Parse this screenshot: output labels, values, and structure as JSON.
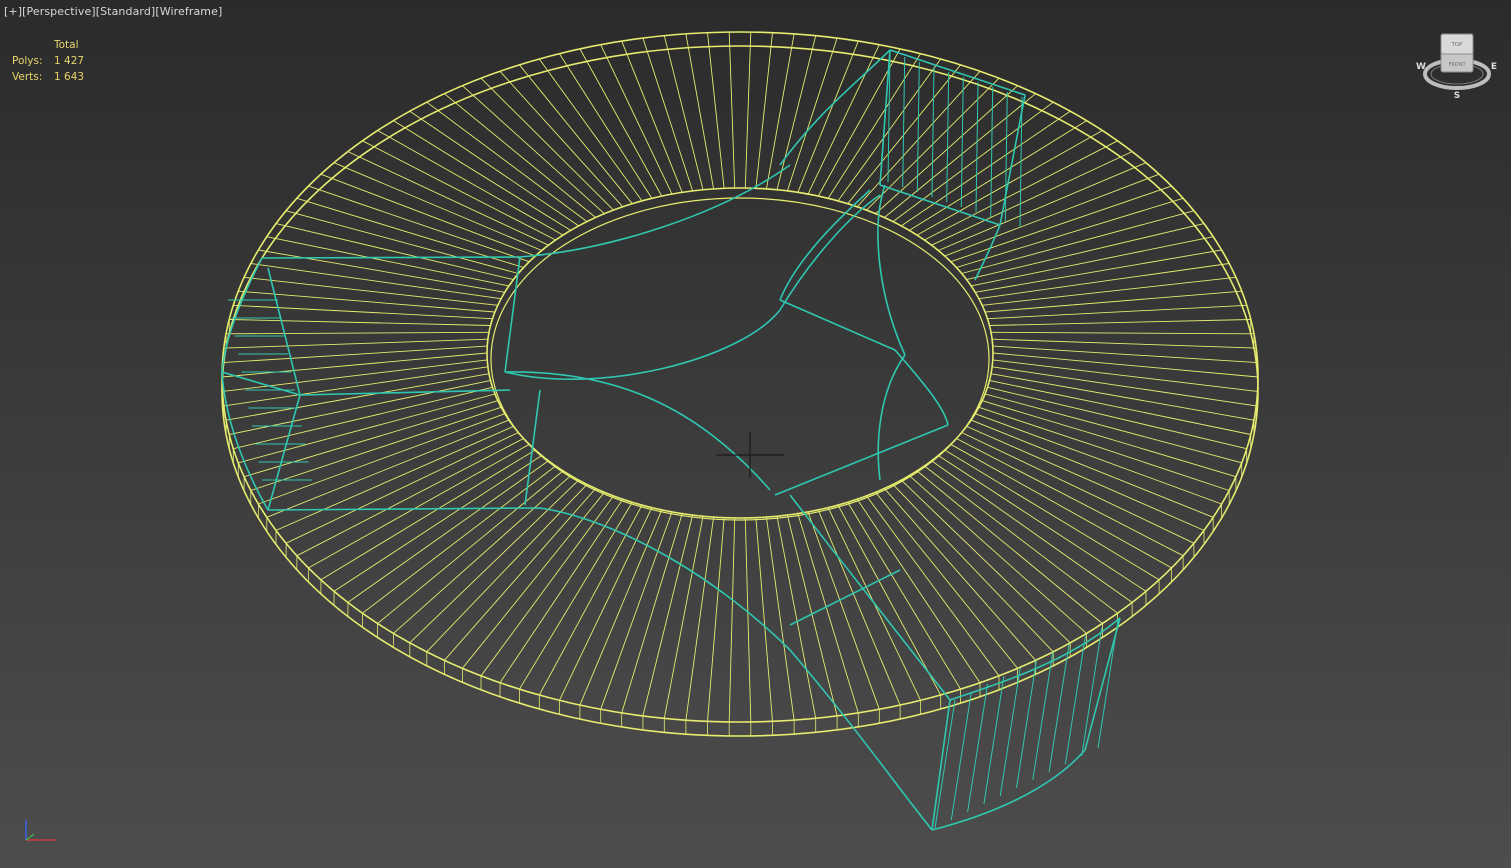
{
  "viewport": {
    "menu_plus": "[+]",
    "view_type": "[Perspective]",
    "shading_preset": "[Standard]",
    "shading_mode": "[Wireframe]"
  },
  "stats": {
    "header": "Total",
    "polys_label": "Polys:",
    "polys_value": "1 427",
    "verts_label": "Verts:",
    "verts_value": "1 643"
  },
  "viewcube": {
    "top_label": "TOP",
    "front_label": "FRONT",
    "west": "W",
    "east": "E",
    "south": "S"
  },
  "colors": {
    "selected_wire": "#e6ec6e",
    "object_wire": "#2fc7b0",
    "background_top": "#2b2b2b",
    "background_bottom": "#4d4d4d",
    "stats_text": "#e8d46a"
  }
}
